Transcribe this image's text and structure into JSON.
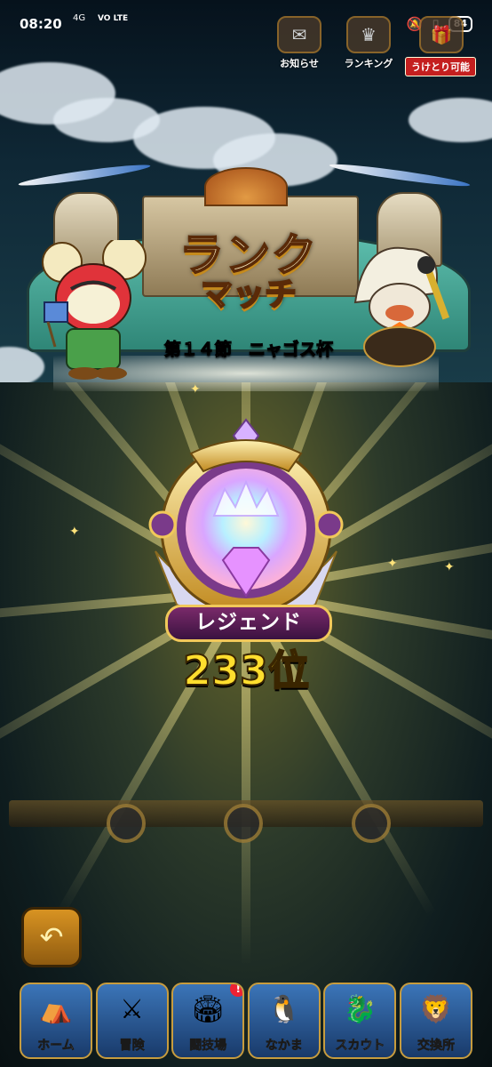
{
  "status_bar": {
    "time": "08:20",
    "network": "4G",
    "volte": "VO LTE",
    "battery": "84"
  },
  "top_buttons": {
    "notice_label": "お知らせ",
    "ranking_label": "ランキング",
    "receive_label": "うけとり可能"
  },
  "title": {
    "line1": "ランク",
    "line2": "マッチ",
    "subtitle": "第１４節　ニャゴス杯"
  },
  "rank": {
    "tier": "レジェンド",
    "position": "233位"
  },
  "nav": [
    {
      "label": "ホーム",
      "icon": "home-tent-icon"
    },
    {
      "label": "冒険",
      "icon": "adventure-icon"
    },
    {
      "label": "闘技場",
      "icon": "arena-icon",
      "badge": "!"
    },
    {
      "label": "なかま",
      "icon": "party-icon"
    },
    {
      "label": "スカウト",
      "icon": "scout-icon"
    },
    {
      "label": "交換所",
      "icon": "exchange-icon"
    }
  ],
  "colors": {
    "rank_value": "#ffde2e",
    "rank_label_bg": "#5a1c55",
    "gold": "#f1c85a"
  }
}
